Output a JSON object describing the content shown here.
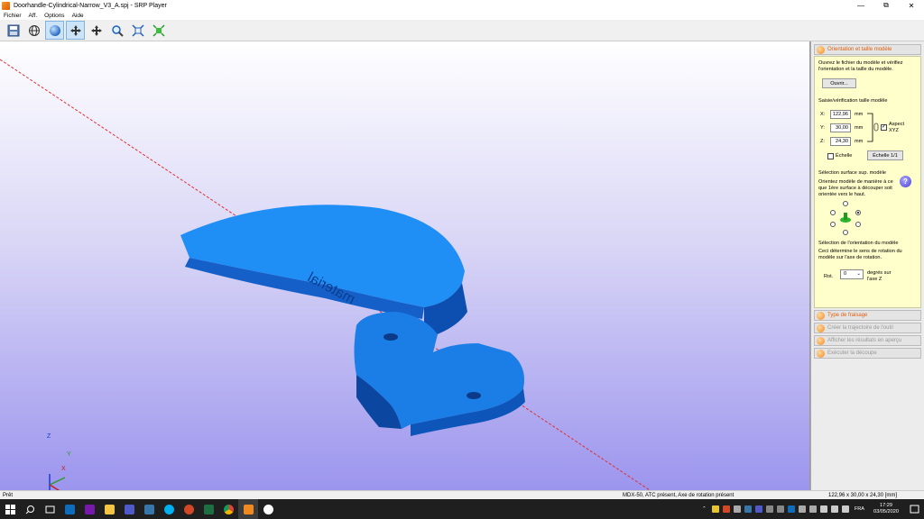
{
  "window": {
    "title": "Doorhandle-Cylindrical-Narrow_V3_A.spj - SRP Player",
    "controls": [
      "minimize",
      "restore",
      "close"
    ]
  },
  "menu": [
    "Fichier",
    "Aff.",
    "Options",
    "Aide"
  ],
  "toolbar": {
    "buttons": [
      {
        "icon": "save-icon",
        "active": false
      },
      {
        "icon": "globe-icon",
        "active": false
      },
      {
        "icon": "sphere-icon",
        "active": true
      },
      {
        "icon": "move-active-icon",
        "active": false
      },
      {
        "icon": "move-icon",
        "active": false
      },
      {
        "icon": "zoom-icon",
        "active": false
      },
      {
        "icon": "fit-icon",
        "active": false
      },
      {
        "icon": "fit-green-icon",
        "active": false
      }
    ]
  },
  "viewport": {
    "axes": {
      "z": "Z",
      "y": "Y",
      "x": "X"
    },
    "model_text": "material",
    "colors": {
      "model": "#1e90ff",
      "axis_line": "#e03030"
    }
  },
  "panel": {
    "sections": [
      {
        "label": "Orientation et taille modèle",
        "active": true
      },
      {
        "label": "Type de fraisage",
        "active": true
      },
      {
        "label": "Créer la trajectoire de l'outil",
        "active": false
      },
      {
        "label": "Afficher les résultats en aperçu",
        "active": false
      },
      {
        "label": "Exécuter la découpe",
        "active": false
      }
    ],
    "intro": "Ouvrez le fichier du modèle et vérifiez l'orientation et la taille du modèle.",
    "open_button": "Ouvrir...",
    "size_heading": "Saisie/vérification taille modèle",
    "x_label": "X:",
    "x_value": "122,96",
    "x_unit": "mm",
    "y_label": "Y:",
    "y_value": "30,00",
    "y_unit": "mm",
    "z_label": "Z:",
    "z_value": "24,30",
    "z_unit": "mm",
    "aspect_label": "Aspect XYZ",
    "aspect_checked": true,
    "scale_label": "Échelle",
    "scale_checked": false,
    "scale_button": "Échelle 1/1",
    "surface_heading": "Sélection surface sup. modèle",
    "surface_text": "Orientez modèle de manière à ce que 1ère surface à découper soit orientée vers le haut.",
    "help_icon": "?",
    "orient_heading": "Sélection de l'orientation du modèle",
    "orient_text": "Ceci détermine le sens de rotation du modèle sur l'axe de rotation.",
    "rot_label": "Rot.",
    "rot_value": "0",
    "rot_unit": "degrés sur l'axe Z"
  },
  "status": {
    "left": "Prêt",
    "middle": "MDX-50, ATC présent, Axe de rotation présent",
    "right": "122,96 x 30,00 x 24,30 [mm]"
  },
  "taskbar": {
    "language": "FRA",
    "time": "17:29",
    "date": "03/05/2020",
    "apps": [
      {
        "name": "start-icon",
        "color": "#ffffff"
      },
      {
        "name": "search-icon",
        "color": "#ffffff"
      },
      {
        "name": "task-view-icon",
        "color": "#ffffff"
      },
      {
        "name": "outlook-icon",
        "color": "#0f6cbd"
      },
      {
        "name": "onenote-icon",
        "color": "#7719aa"
      },
      {
        "name": "explorer-icon",
        "color": "#f4c542"
      },
      {
        "name": "teams-icon",
        "color": "#5059c9"
      },
      {
        "name": "python-icon",
        "color": "#3776ab"
      },
      {
        "name": "skype-icon",
        "color": "#00aff0"
      },
      {
        "name": "powerpoint-icon",
        "color": "#d24726"
      },
      {
        "name": "excel-icon",
        "color": "#1d6f42"
      },
      {
        "name": "chrome-icon",
        "color": "#e8c430"
      },
      {
        "name": "srp-player-icon",
        "color": "#f08a20"
      },
      {
        "name": "cloud-app-icon",
        "color": "#ffffff"
      }
    ]
  }
}
